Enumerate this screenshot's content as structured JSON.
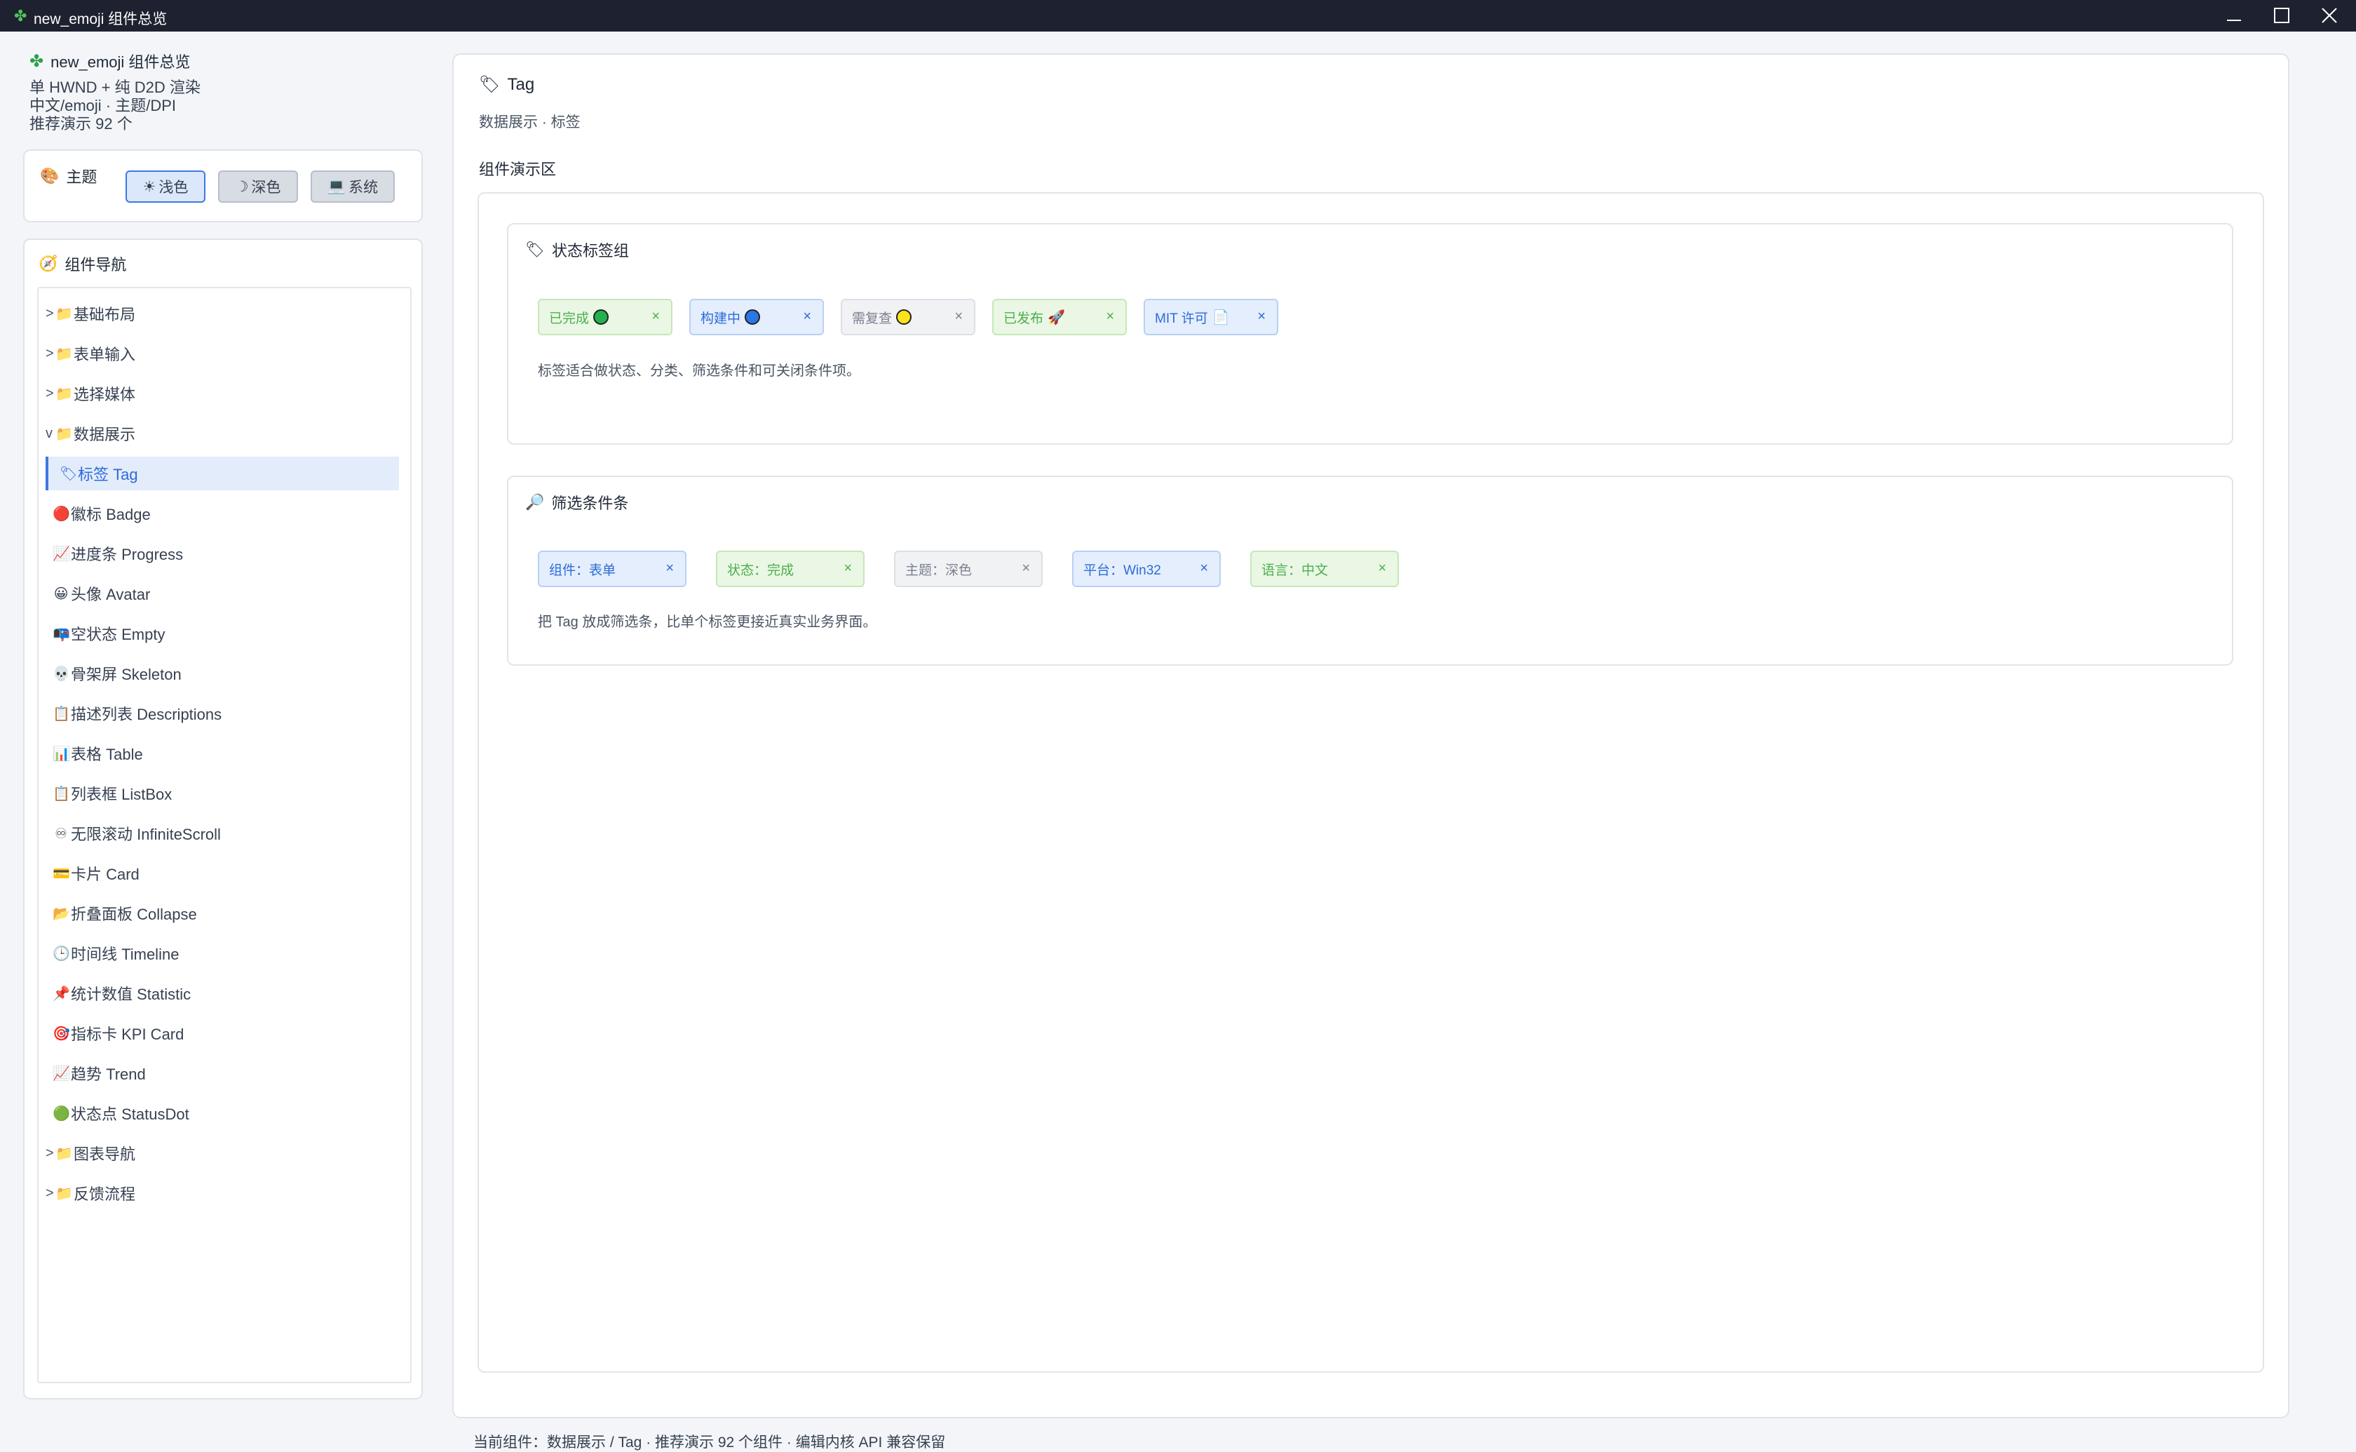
{
  "window": {
    "title": "new_emoji 组件总览"
  },
  "sidebar": {
    "app_name": "new_emoji 组件总览",
    "info_lines": [
      "单 HWND + 纯 D2D 渲染",
      "中文/emoji · 主题/DPI",
      "推荐演示 92 个"
    ],
    "theme": {
      "label": "主题",
      "options": [
        {
          "label": "浅色",
          "icon": "sun-icon",
          "selected": true
        },
        {
          "label": "深色",
          "icon": "moon-icon",
          "selected": false
        },
        {
          "label": "系统",
          "icon": "laptop-icon",
          "selected": false
        }
      ]
    },
    "nav_title": "组件导航",
    "groups_before": [
      {
        "expander": ">",
        "label": "基础布局"
      },
      {
        "expander": ">",
        "label": "表单输入"
      },
      {
        "expander": ">",
        "label": "选择媒体"
      }
    ],
    "open_group": {
      "expander": "v",
      "label": "数据展示"
    },
    "items": [
      {
        "label": "标签 Tag",
        "icon": "🏷"
      },
      {
        "label": "徽标 Badge",
        "icon": "🔴"
      },
      {
        "label": "进度条 Progress",
        "icon": "📈"
      },
      {
        "label": "头像 Avatar",
        "icon": "😀"
      },
      {
        "label": "空状态 Empty",
        "icon": "📭"
      },
      {
        "label": "骨架屏 Skeleton",
        "icon": "💀"
      },
      {
        "label": "描述列表 Descriptions",
        "icon": "📋"
      },
      {
        "label": "表格 Table",
        "icon": "📊"
      },
      {
        "label": "列表框 ListBox",
        "icon": "📋"
      },
      {
        "label": "无限滚动 InfiniteScroll",
        "icon": "♾"
      },
      {
        "label": "卡片 Card",
        "icon": "💳"
      },
      {
        "label": "折叠面板 Collapse",
        "icon": "📂"
      },
      {
        "label": "时间线 Timeline",
        "icon": "🕒"
      },
      {
        "label": "统计数值 Statistic",
        "icon": "📌"
      },
      {
        "label": "指标卡 KPI Card",
        "icon": "🎯"
      },
      {
        "label": "趋势 Trend",
        "icon": "📈"
      },
      {
        "label": "状态点 StatusDot",
        "icon": "🟢"
      }
    ],
    "selected_index": 0,
    "groups_after": [
      {
        "expander": ">",
        "label": "图表导航"
      },
      {
        "expander": ">",
        "label": "反馈流程"
      }
    ]
  },
  "main": {
    "title": "Tag",
    "subtitle": "数据展示 · 标签",
    "demo_title": "组件演示区",
    "section1": {
      "title": "状态标签组",
      "tags": [
        {
          "label": "已完成",
          "style": "green",
          "symbol": "green-circle"
        },
        {
          "label": "构建中",
          "style": "blue",
          "symbol": "blue-circle"
        },
        {
          "label": "需复查",
          "style": "gray",
          "symbol": "yellow-circle"
        },
        {
          "label": "已发布",
          "style": "green",
          "symbol": "rocket"
        },
        {
          "label": "MIT 许可",
          "style": "blue",
          "symbol": "document"
        }
      ],
      "description": "标签适合做状态、分类、筛选条件和可关闭条件项。"
    },
    "section2": {
      "title": "筛选条件条",
      "tags": [
        {
          "label": "组件：表单",
          "style": "blue"
        },
        {
          "label": "状态：完成",
          "style": "green"
        },
        {
          "label": "主题：深色",
          "style": "gray"
        },
        {
          "label": "平台：Win32",
          "style": "blue"
        },
        {
          "label": "语言：中文",
          "style": "green"
        }
      ],
      "description": "把 Tag 放成筛选条，比单个标签更接近真实业务界面。"
    }
  },
  "statusbar": {
    "text": "当前组件：数据展示 / Tag · 推荐演示 92 个组件 · 编辑内核 API 兼容保留"
  },
  "colors": {
    "accent": "#3f78e0",
    "tag_green": "#4caf50",
    "tag_blue": "#2d6bd8",
    "tag_gray": "#7b8190"
  }
}
